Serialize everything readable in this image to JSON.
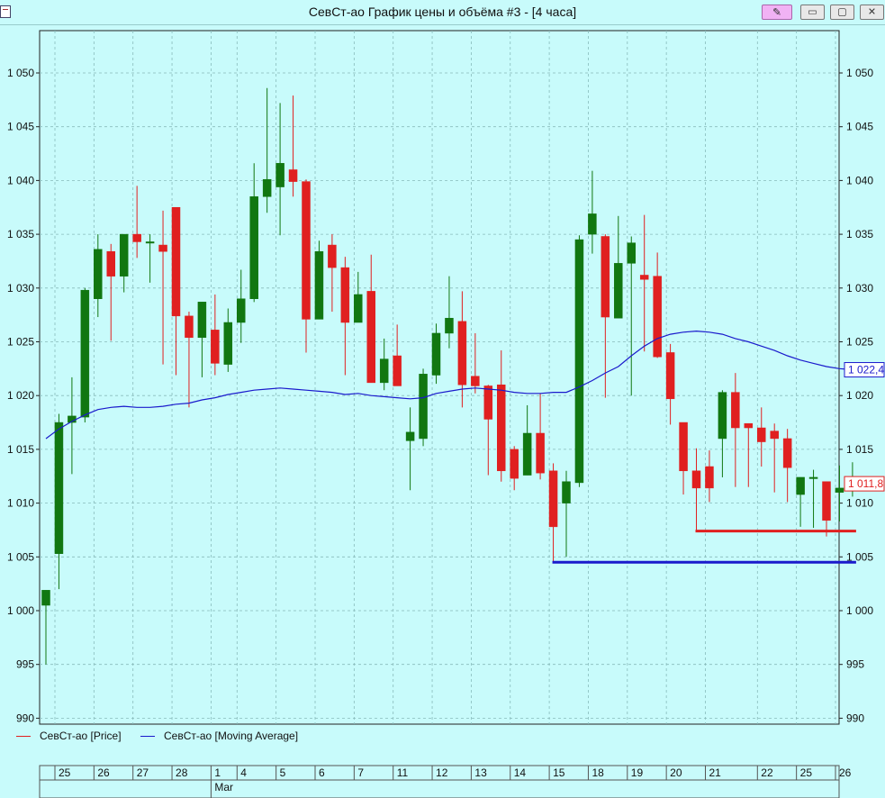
{
  "window": {
    "title": "СевСт-ао График цены и объёма #3 - [4 часа]"
  },
  "titlebar_buttons": {
    "pin_icon": "pin-icon",
    "minimize_icon": "minimize-icon",
    "maximize_icon": "maximize-icon",
    "close_icon": "close-icon"
  },
  "chart_data": {
    "type": "candlestick",
    "y_ticks": [
      "1 050",
      "1 045",
      "1 040",
      "1 035",
      "1 030",
      "1 025",
      "1 020",
      "1 015",
      "1 010",
      "1 005",
      "1 000",
      "995",
      "990"
    ],
    "y_tick_values": [
      1050,
      1045,
      1040,
      1035,
      1030,
      1025,
      1020,
      1015,
      1010,
      1005,
      1000,
      995,
      990
    ],
    "ylim": [
      989.5,
      1053.5
    ],
    "grid": true,
    "x_tick_labels": [
      "25",
      "26",
      "27",
      "28",
      "1",
      "4",
      "5",
      "6",
      "7",
      "11",
      "12",
      "13",
      "14",
      "15",
      "18",
      "19",
      "20",
      "21",
      "22",
      "25",
      "26"
    ],
    "month_label": "Mar",
    "candles": [
      [
        1000.5,
        1001.9,
        995.0,
        1001.9
      ],
      [
        1005.3,
        1017.5,
        1002.0,
        1018.3
      ],
      [
        1017.5,
        1018.1,
        1012.7,
        1021.7
      ],
      [
        1018.0,
        1029.8,
        1017.5,
        1030.0
      ],
      [
        1029.0,
        1033.6,
        1027.3,
        1035.0
      ],
      [
        1033.4,
        1031.1,
        1025.1,
        1034.1
      ],
      [
        1031.1,
        1035.0,
        1029.6,
        1035.0
      ],
      [
        1035.0,
        1034.3,
        1032.8,
        1039.5
      ],
      [
        1034.3,
        1034.3,
        1030.5,
        1035.0
      ],
      [
        1034.0,
        1033.4,
        1022.9,
        1037.2
      ],
      [
        1037.5,
        1027.4,
        1021.9,
        1037.2
      ],
      [
        1027.4,
        1025.4,
        1018.9,
        1027.8
      ],
      [
        1025.4,
        1028.7,
        1021.7,
        1028.7
      ],
      [
        1026.1,
        1023.0,
        1021.9,
        1029.4
      ],
      [
        1022.9,
        1026.8,
        1022.2,
        1028.1
      ],
      [
        1026.8,
        1029.0,
        1024.9,
        1031.7
      ],
      [
        1029.0,
        1038.5,
        1028.7,
        1041.6
      ],
      [
        1038.5,
        1040.1,
        1037.0,
        1048.6
      ],
      [
        1039.4,
        1041.6,
        1034.9,
        1047.2
      ],
      [
        1041.0,
        1039.9,
        1038.5,
        1047.9
      ],
      [
        1039.9,
        1027.1,
        1024.0,
        1040.1
      ],
      [
        1027.1,
        1033.4,
        1027.1,
        1034.4
      ],
      [
        1034.0,
        1031.9,
        1027.8,
        1035.0
      ],
      [
        1031.9,
        1026.8,
        1021.9,
        1032.9
      ],
      [
        1026.8,
        1029.4,
        1026.8,
        1031.5
      ],
      [
        1029.7,
        1021.2,
        1021.2,
        1033.1
      ],
      [
        1021.2,
        1023.4,
        1020.5,
        1025.3
      ],
      [
        1023.7,
        1020.9,
        1020.9,
        1026.6
      ],
      [
        1015.8,
        1016.6,
        1011.2,
        1018.9
      ],
      [
        1016.0,
        1022.0,
        1015.3,
        1022.5
      ],
      [
        1021.9,
        1025.8,
        1021.1,
        1026.7
      ],
      [
        1025.8,
        1027.2,
        1024.4,
        1031.1
      ],
      [
        1026.9,
        1021.0,
        1018.9,
        1029.7
      ],
      [
        1021.8,
        1020.9,
        1020.2,
        1025.8
      ],
      [
        1020.9,
        1017.8,
        1012.6,
        1021.0
      ],
      [
        1021.0,
        1013.0,
        1012.0,
        1024.2
      ],
      [
        1015.0,
        1012.3,
        1011.2,
        1015.3
      ],
      [
        1012.6,
        1016.5,
        1012.6,
        1019.1
      ],
      [
        1016.5,
        1012.8,
        1012.2,
        1020.2
      ],
      [
        1013.0,
        1007.8,
        1004.4,
        1013.7
      ],
      [
        1010.0,
        1012.0,
        1005.0,
        1013.0
      ],
      [
        1011.9,
        1034.5,
        1011.5,
        1034.9
      ],
      [
        1035.0,
        1036.9,
        1033.2,
        1040.9
      ],
      [
        1034.8,
        1027.3,
        1019.8,
        1035.0
      ],
      [
        1027.2,
        1032.3,
        1027.2,
        1036.7
      ],
      [
        1032.3,
        1034.2,
        1020.0,
        1034.8
      ],
      [
        1031.2,
        1030.8,
        1024.1,
        1036.8
      ],
      [
        1031.1,
        1023.6,
        1023.5,
        1033.3
      ],
      [
        1024.0,
        1019.7,
        1017.3,
        1024.8
      ],
      [
        1017.5,
        1013.0,
        1010.8,
        1017.5
      ],
      [
        1013.0,
        1011.4,
        1007.5,
        1015.1
      ],
      [
        1013.4,
        1011.4,
        1010.1,
        1014.9
      ],
      [
        1016.0,
        1020.3,
        1012.4,
        1020.5
      ],
      [
        1020.3,
        1017.0,
        1011.5,
        1022.1
      ],
      [
        1017.4,
        1017.0,
        1011.5,
        1017.4
      ],
      [
        1017.0,
        1015.7,
        1013.4,
        1018.9
      ],
      [
        1016.7,
        1016.0,
        1011.0,
        1017.4
      ],
      [
        1016.0,
        1013.3,
        1010.1,
        1016.9
      ],
      [
        1010.8,
        1012.4,
        1007.8,
        1012.4
      ],
      [
        1012.4,
        1012.4,
        1007.7,
        1013.1
      ],
      [
        1012.0,
        1008.4,
        1006.9,
        1012.0
      ],
      [
        1011.0,
        1011.4,
        1008.3,
        1013.5
      ],
      [
        1011.2,
        1011.8,
        1010.6,
        1013.8
      ]
    ],
    "candle_index_for_day_label": [
      0,
      3,
      6,
      9,
      12,
      14,
      17,
      20,
      23,
      26,
      29,
      32,
      35,
      38,
      41,
      44,
      47,
      50,
      54,
      57,
      60
    ],
    "series": [
      {
        "name": "СевСт-ао [Price]",
        "color": "#e02020"
      },
      {
        "name": "СевСт-ао [Moving Average]",
        "color": "#1a1acc",
        "values": [
          1016.0,
          1016.9,
          1017.6,
          1018.2,
          1018.7,
          1018.9,
          1019.0,
          1018.9,
          1018.9,
          1019.0,
          1019.2,
          1019.3,
          1019.6,
          1019.8,
          1020.1,
          1020.3,
          1020.5,
          1020.6,
          1020.7,
          1020.6,
          1020.5,
          1020.4,
          1020.3,
          1020.1,
          1020.2,
          1020.0,
          1019.9,
          1019.8,
          1019.7,
          1019.8,
          1020.2,
          1020.4,
          1020.6,
          1020.7,
          1020.6,
          1020.5,
          1020.3,
          1020.2,
          1020.2,
          1020.3,
          1020.3,
          1020.8,
          1021.4,
          1022.1,
          1022.7,
          1023.7,
          1024.6,
          1025.3,
          1025.7,
          1025.9,
          1026.0,
          1025.9,
          1025.7,
          1025.3,
          1025.0,
          1024.6,
          1024.2,
          1023.7,
          1023.3,
          1023.0,
          1022.7,
          1022.5,
          1022.4
        ]
      }
    ],
    "price_labels": {
      "moving_average_last": "1 022,4",
      "price_last": "1 011,8"
    },
    "levels": [
      {
        "value": 1007.4,
        "from_candle": 50,
        "color": "#e02020"
      },
      {
        "value": 1004.5,
        "from_candle": 39,
        "color": "#1a1acc"
      }
    ],
    "colors": {
      "up": "#117711",
      "down": "#e02020",
      "grid": "#88bbbb",
      "plot_bg": "#c8fbfb"
    }
  },
  "legend": {
    "price": "СевСт-ао [Price]",
    "moving_average": "СевСт-ао [Moving Average]"
  }
}
